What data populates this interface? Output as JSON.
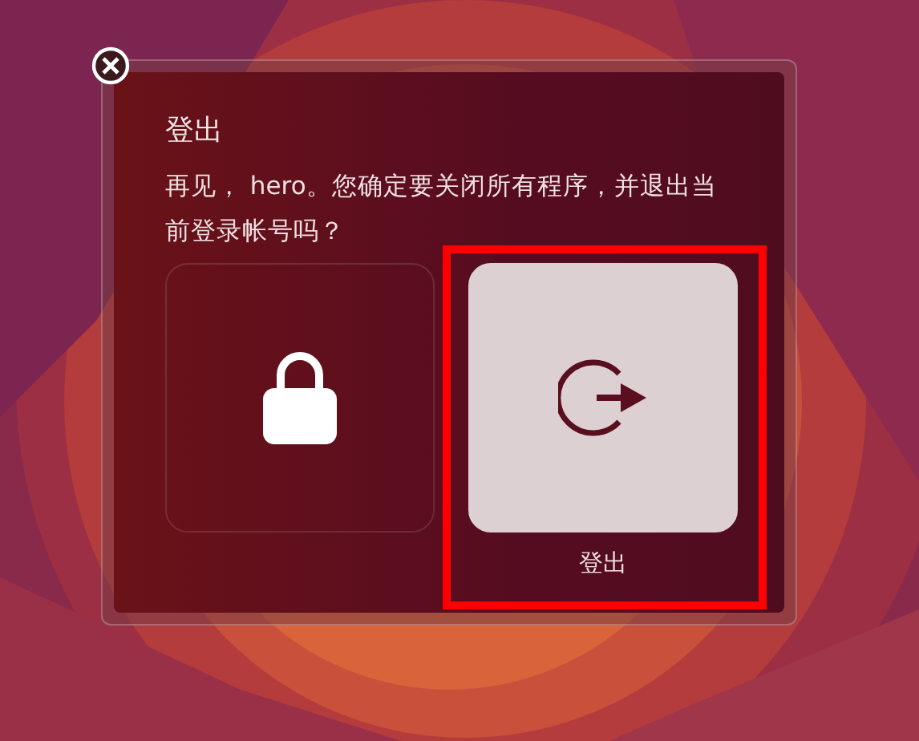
{
  "dialog": {
    "title": "登出",
    "message": "再见， hero。您确定要关闭所有程序，并退出当前登录帐号吗？",
    "options": [
      {
        "kind": "lock",
        "selected": false
      },
      {
        "kind": "logout",
        "label": "登出",
        "selected": true
      }
    ]
  }
}
